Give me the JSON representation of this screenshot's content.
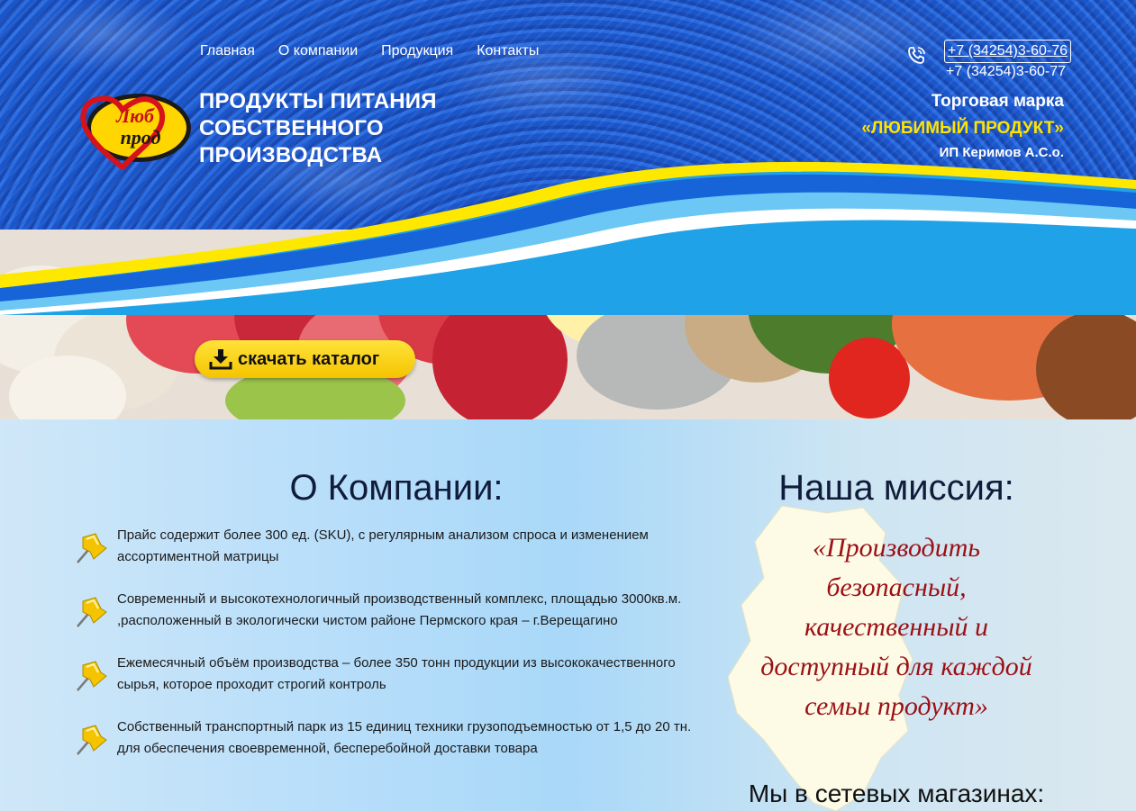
{
  "nav": {
    "items": [
      {
        "label": "Главная"
      },
      {
        "label": "О компании"
      },
      {
        "label": "Продукция"
      },
      {
        "label": "Контакты"
      }
    ]
  },
  "logo": {
    "line1": "Люб",
    "line2": "прод"
  },
  "header": {
    "tagline": "ПРОДУКТЫ ПИТАНИЯ СОБСТВЕННОГО ПРОИЗВОДСТВА",
    "phone1": "+7 (34254)3-60-76",
    "phone2": "+7 (34254)3-60-77",
    "brand_label": "Торговая марка",
    "brand_name": "«ЛЮБИМЫЙ ПРОДУКТ»",
    "owner": "ИП Керимов А.С.о."
  },
  "hero": {
    "download_label": "скачать каталог"
  },
  "about": {
    "title": "О Компании:",
    "items": [
      {
        "text": "Прайс содержит более 300 ед. (SKU), с регулярным анализом спроса и изменением ассортиментной матрицы"
      },
      {
        "text": "Современный и высокотехнологичный производственный комплекс, площадью 3000кв.м. ,расположенный в экологически чистом районе Пермского края – г.Верещагино"
      },
      {
        "text": "Ежемесячный объём производства – более 350 тонн продукции из высококачественного сырья, которое проходит строгий контроль"
      },
      {
        "text": "Собственный транспортный парк из 15 единиц техники грузоподъемностью от 1,5 до 20 тн. для обеспечения своевременной, бесперебойной доставки товара"
      }
    ]
  },
  "mission": {
    "title": "Наша миссия:",
    "text": "«Производить безопасный, качественный и доступный для каждой семьи продукт»"
  },
  "stores": {
    "title": "Мы в сетевых магазинах:"
  },
  "colors": {
    "header_blue": "#1d56c8",
    "accent_yellow": "#ffe400",
    "mission_red": "#9b1015",
    "title_navy": "#111c3a"
  }
}
